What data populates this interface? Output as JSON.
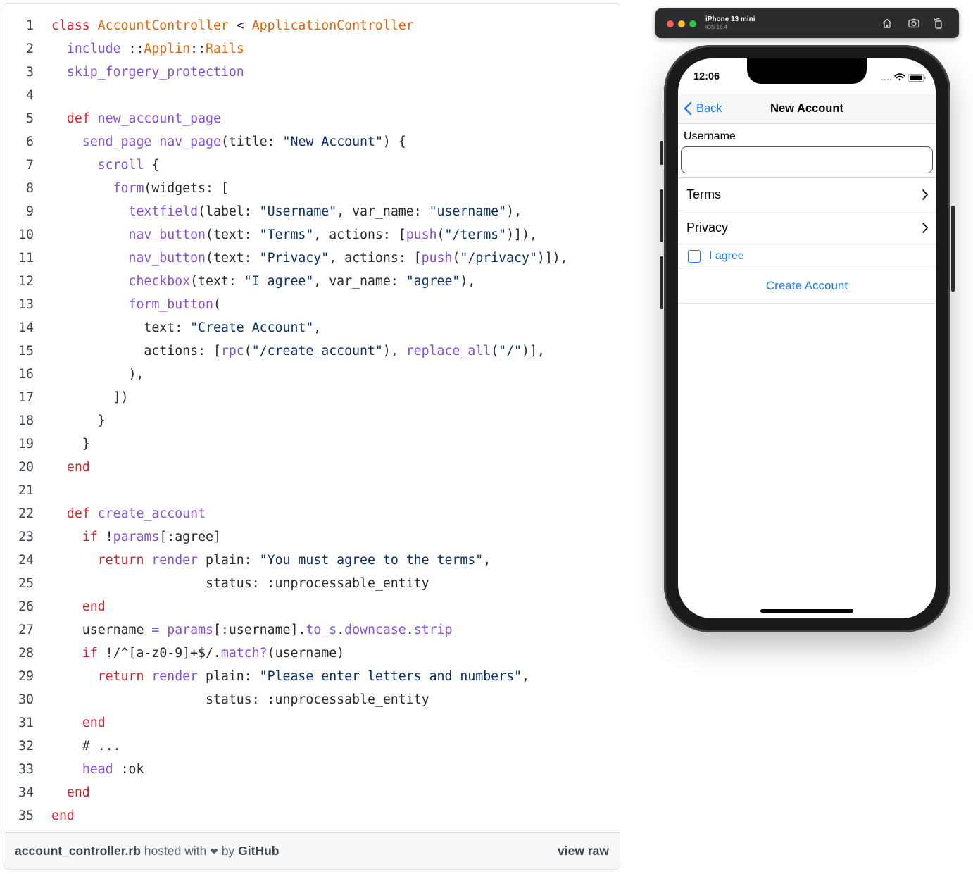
{
  "gist": {
    "code_lines": [
      [
        {
          "c": "k",
          "t": "class "
        },
        {
          "c": "c",
          "t": "AccountController"
        },
        {
          "c": "t",
          "t": " < "
        },
        {
          "c": "c",
          "t": "ApplicationController"
        }
      ],
      [
        {
          "c": "t",
          "t": "  "
        },
        {
          "c": "f",
          "t": "include"
        },
        {
          "c": "t",
          "t": " ::"
        },
        {
          "c": "c",
          "t": "Applin"
        },
        {
          "c": "t",
          "t": "::"
        },
        {
          "c": "c",
          "t": "Rails"
        }
      ],
      [
        {
          "c": "t",
          "t": "  "
        },
        {
          "c": "f",
          "t": "skip_forgery_protection"
        }
      ],
      [],
      [
        {
          "c": "t",
          "t": "  "
        },
        {
          "c": "k",
          "t": "def "
        },
        {
          "c": "f",
          "t": "new_account_page"
        }
      ],
      [
        {
          "c": "t",
          "t": "    "
        },
        {
          "c": "f",
          "t": "send_page"
        },
        {
          "c": "t",
          "t": " "
        },
        {
          "c": "f",
          "t": "nav_page"
        },
        {
          "c": "t",
          "t": "(title: "
        },
        {
          "c": "s",
          "t": "\"New Account\""
        },
        {
          "c": "t",
          "t": ") {"
        }
      ],
      [
        {
          "c": "t",
          "t": "      "
        },
        {
          "c": "f",
          "t": "scroll"
        },
        {
          "c": "t",
          "t": " {"
        }
      ],
      [
        {
          "c": "t",
          "t": "        "
        },
        {
          "c": "f",
          "t": "form"
        },
        {
          "c": "t",
          "t": "(widgets: ["
        }
      ],
      [
        {
          "c": "t",
          "t": "          "
        },
        {
          "c": "f",
          "t": "textfield"
        },
        {
          "c": "t",
          "t": "(label: "
        },
        {
          "c": "s",
          "t": "\"Username\""
        },
        {
          "c": "t",
          "t": ", var_name: "
        },
        {
          "c": "s",
          "t": "\"username\""
        },
        {
          "c": "t",
          "t": "),"
        }
      ],
      [
        {
          "c": "t",
          "t": "          "
        },
        {
          "c": "f",
          "t": "nav_button"
        },
        {
          "c": "t",
          "t": "(text: "
        },
        {
          "c": "s",
          "t": "\"Terms\""
        },
        {
          "c": "t",
          "t": ", actions: ["
        },
        {
          "c": "f",
          "t": "push"
        },
        {
          "c": "t",
          "t": "("
        },
        {
          "c": "s",
          "t": "\"/terms\""
        },
        {
          "c": "t",
          "t": ")]),"
        }
      ],
      [
        {
          "c": "t",
          "t": "          "
        },
        {
          "c": "f",
          "t": "nav_button"
        },
        {
          "c": "t",
          "t": "(text: "
        },
        {
          "c": "s",
          "t": "\"Privacy\""
        },
        {
          "c": "t",
          "t": ", actions: ["
        },
        {
          "c": "f",
          "t": "push"
        },
        {
          "c": "t",
          "t": "("
        },
        {
          "c": "s",
          "t": "\"/privacy\""
        },
        {
          "c": "t",
          "t": ")]),"
        }
      ],
      [
        {
          "c": "t",
          "t": "          "
        },
        {
          "c": "f",
          "t": "checkbox"
        },
        {
          "c": "t",
          "t": "(text: "
        },
        {
          "c": "s",
          "t": "\"I agree\""
        },
        {
          "c": "t",
          "t": ", var_name: "
        },
        {
          "c": "s",
          "t": "\"agree\""
        },
        {
          "c": "t",
          "t": "),"
        }
      ],
      [
        {
          "c": "t",
          "t": "          "
        },
        {
          "c": "f",
          "t": "form_button"
        },
        {
          "c": "t",
          "t": "("
        }
      ],
      [
        {
          "c": "t",
          "t": "            text: "
        },
        {
          "c": "s",
          "t": "\"Create Account\""
        },
        {
          "c": "t",
          "t": ","
        }
      ],
      [
        {
          "c": "t",
          "t": "            actions: ["
        },
        {
          "c": "f",
          "t": "rpc"
        },
        {
          "c": "t",
          "t": "("
        },
        {
          "c": "s",
          "t": "\"/create_account\""
        },
        {
          "c": "t",
          "t": "), "
        },
        {
          "c": "f",
          "t": "replace_all"
        },
        {
          "c": "t",
          "t": "("
        },
        {
          "c": "s",
          "t": "\"/\""
        },
        {
          "c": "t",
          "t": ")],"
        }
      ],
      [
        {
          "c": "t",
          "t": "          ),"
        }
      ],
      [
        {
          "c": "t",
          "t": "        ])"
        }
      ],
      [
        {
          "c": "t",
          "t": "      }"
        }
      ],
      [
        {
          "c": "t",
          "t": "    }"
        }
      ],
      [
        {
          "c": "t",
          "t": "  "
        },
        {
          "c": "k",
          "t": "end"
        }
      ],
      [],
      [
        {
          "c": "t",
          "t": "  "
        },
        {
          "c": "k",
          "t": "def "
        },
        {
          "c": "f",
          "t": "create_account"
        }
      ],
      [
        {
          "c": "t",
          "t": "    "
        },
        {
          "c": "k",
          "t": "if"
        },
        {
          "c": "t",
          "t": " !"
        },
        {
          "c": "f",
          "t": "params"
        },
        {
          "c": "t",
          "t": "[:agree]"
        }
      ],
      [
        {
          "c": "t",
          "t": "      "
        },
        {
          "c": "k",
          "t": "return"
        },
        {
          "c": "t",
          "t": " "
        },
        {
          "c": "f",
          "t": "render"
        },
        {
          "c": "t",
          "t": " plain: "
        },
        {
          "c": "s",
          "t": "\"You must agree to the terms\""
        },
        {
          "c": "t",
          "t": ","
        }
      ],
      [
        {
          "c": "t",
          "t": "                    status: :unprocessable_entity"
        }
      ],
      [
        {
          "c": "t",
          "t": "    "
        },
        {
          "c": "k",
          "t": "end"
        }
      ],
      [
        {
          "c": "t",
          "t": "    username "
        },
        {
          "c": "f",
          "t": "="
        },
        {
          "c": "t",
          "t": " "
        },
        {
          "c": "f",
          "t": "params"
        },
        {
          "c": "t",
          "t": "[:username]."
        },
        {
          "c": "f",
          "t": "to_s"
        },
        {
          "c": "t",
          "t": "."
        },
        {
          "c": "f",
          "t": "downcase"
        },
        {
          "c": "t",
          "t": "."
        },
        {
          "c": "f",
          "t": "strip"
        }
      ],
      [
        {
          "c": "t",
          "t": "    "
        },
        {
          "c": "k",
          "t": "if"
        },
        {
          "c": "t",
          "t": " !/^[a-z0-9]+$/."
        },
        {
          "c": "f",
          "t": "match?"
        },
        {
          "c": "t",
          "t": "(username)"
        }
      ],
      [
        {
          "c": "t",
          "t": "      "
        },
        {
          "c": "k",
          "t": "return"
        },
        {
          "c": "t",
          "t": " "
        },
        {
          "c": "f",
          "t": "render"
        },
        {
          "c": "t",
          "t": " plain: "
        },
        {
          "c": "s",
          "t": "\"Please enter letters and numbers\""
        },
        {
          "c": "t",
          "t": ","
        }
      ],
      [
        {
          "c": "t",
          "t": "                    status: :unprocessable_entity"
        }
      ],
      [
        {
          "c": "t",
          "t": "    "
        },
        {
          "c": "k",
          "t": "end"
        }
      ],
      [
        {
          "c": "t",
          "t": "    # ..."
        }
      ],
      [
        {
          "c": "t",
          "t": "    "
        },
        {
          "c": "f",
          "t": "head"
        },
        {
          "c": "t",
          "t": " :ok"
        }
      ],
      [
        {
          "c": "t",
          "t": "  "
        },
        {
          "c": "k",
          "t": "end"
        }
      ],
      [
        {
          "c": "k",
          "t": "end"
        }
      ]
    ],
    "footer": {
      "filename": "account_controller.rb",
      "hosted_with": " hosted with ",
      "heart": "❤",
      "by": " by ",
      "host": "GitHub",
      "view_raw": "view raw"
    }
  },
  "simulator": {
    "device": "iPhone 13 mini",
    "os": "iOS 16.4",
    "icons": [
      "home-icon",
      "screenshot-icon",
      "rotate-icon"
    ]
  },
  "phone": {
    "time": "12:06",
    "nav": {
      "back_label": "Back",
      "title": "New Account"
    },
    "form": {
      "username_label": "Username",
      "username_value": "",
      "rows": [
        {
          "label": "Terms"
        },
        {
          "label": "Privacy"
        }
      ],
      "checkbox_label": "I agree",
      "checkbox_checked": false,
      "submit_label": "Create Account"
    },
    "accent_color": "#1a7bf2"
  }
}
